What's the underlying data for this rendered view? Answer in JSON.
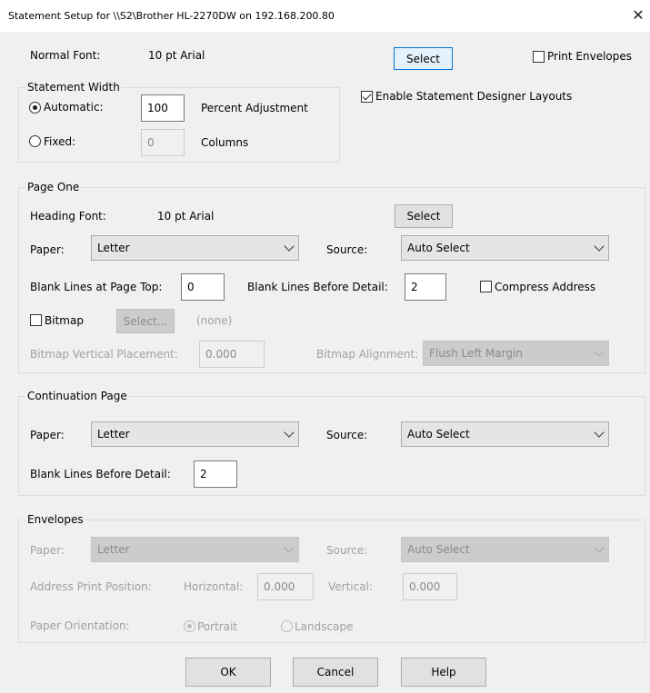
{
  "window": {
    "title": "Statement Setup for \\\\S2\\Brother HL-2270DW on 192.168.200.80",
    "close_glyph": "✕"
  },
  "top": {
    "normal_font_label": "Normal Font:",
    "normal_font_value": "10 pt Arial",
    "select_label": "Select",
    "print_envelopes_label": "Print Envelopes",
    "print_envelopes_checked": false,
    "enable_designer_label": "Enable Statement Designer Layouts",
    "enable_designer_checked": true
  },
  "statement_width": {
    "title": "Statement Width",
    "automatic_label": "Automatic:",
    "automatic_value": "100",
    "automatic_suffix": "Percent Adjustment",
    "fixed_label": "Fixed:",
    "fixed_value": "0",
    "fixed_suffix": "Columns",
    "selected": "automatic"
  },
  "page_one": {
    "title": "Page One",
    "heading_font_label": "Heading Font:",
    "heading_font_value": "10 pt Arial",
    "select_label": "Select",
    "paper_label": "Paper:",
    "paper_value": "Letter",
    "source_label": "Source:",
    "source_value": "Auto Select",
    "blank_top_label": "Blank Lines at Page Top:",
    "blank_top_value": "0",
    "blank_detail_label": "Blank Lines Before Detail:",
    "blank_detail_value": "2",
    "compress_label": "Compress Address",
    "compress_checked": false,
    "bitmap_label": "Bitmap",
    "bitmap_checked": false,
    "bitmap_select_label": "Select...",
    "bitmap_none": "(none)",
    "bitmap_vertical_label": "Bitmap Vertical Placement:",
    "bitmap_vertical_value": "0.000",
    "bitmap_alignment_label": "Bitmap Alignment:",
    "bitmap_alignment_value": "Flush Left Margin"
  },
  "continuation": {
    "title": "Continuation Page",
    "paper_label": "Paper:",
    "paper_value": "Letter",
    "source_label": "Source:",
    "source_value": "Auto Select",
    "blank_detail_label": "Blank Lines Before Detail:",
    "blank_detail_value": "2"
  },
  "envelopes": {
    "title": "Envelopes",
    "paper_label": "Paper:",
    "paper_value": "Letter",
    "source_label": "Source:",
    "source_value": "Auto Select",
    "address_label": "Address Print Position:",
    "horizontal_label": "Horizontal:",
    "horizontal_value": "0.000",
    "vertical_label": "Vertical:",
    "vertical_value": "0.000",
    "orientation_label": "Paper Orientation:",
    "portrait_label": "Portrait",
    "landscape_label": "Landscape",
    "orientation_selected": "portrait"
  },
  "footer": {
    "ok_label": "OK",
    "cancel_label": "Cancel",
    "help_label": "Help"
  }
}
